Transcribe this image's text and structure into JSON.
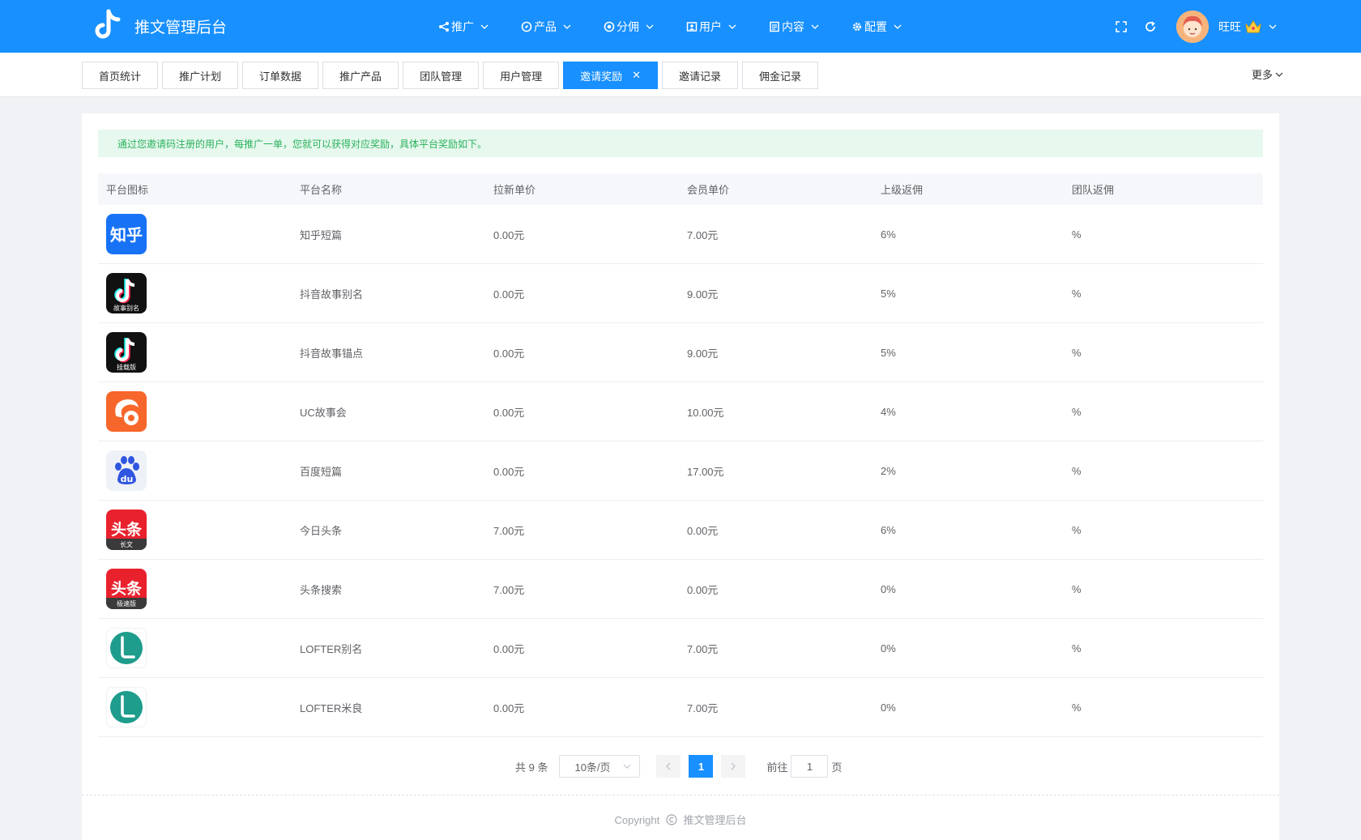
{
  "header": {
    "title": "推文管理后台",
    "nav": [
      {
        "label": "推广",
        "icon": "share-icon"
      },
      {
        "label": "产品",
        "icon": "compass-icon"
      },
      {
        "label": "分佣",
        "icon": "target-icon"
      },
      {
        "label": "用户",
        "icon": "user-card-icon"
      },
      {
        "label": "内容",
        "icon": "document-icon"
      },
      {
        "label": "配置",
        "icon": "gear-icon"
      }
    ],
    "username": "旺旺"
  },
  "tabs": [
    {
      "label": "首页统计",
      "active": false
    },
    {
      "label": "推广计划",
      "active": false
    },
    {
      "label": "订单数据",
      "active": false
    },
    {
      "label": "推广产品",
      "active": false
    },
    {
      "label": "团队管理",
      "active": false
    },
    {
      "label": "用户管理",
      "active": false
    },
    {
      "label": "邀请奖励",
      "active": true
    },
    {
      "label": "邀请记录",
      "active": false
    },
    {
      "label": "佣金记录",
      "active": false
    }
  ],
  "more_label": "更多",
  "notice": "通过您邀请码注册的用户，每推广一单，您就可以获得对应奖励，具体平台奖励如下。",
  "table": {
    "columns": [
      "平台图标",
      "平台名称",
      "拉新单价",
      "会员单价",
      "上级返佣",
      "团队返佣"
    ],
    "rows": [
      {
        "icon": "zhihu-logo-icon",
        "name": "知乎短篇",
        "new_price": "0.00元",
        "member_price": "7.00元",
        "upline": "6%",
        "team": "%"
      },
      {
        "icon": "douyin-story-alias-icon",
        "name": "抖音故事别名",
        "new_price": "0.00元",
        "member_price": "9.00元",
        "upline": "5%",
        "team": "%"
      },
      {
        "icon": "douyin-story-anchor-icon",
        "name": "抖音故事锚点",
        "new_price": "0.00元",
        "member_price": "9.00元",
        "upline": "5%",
        "team": "%"
      },
      {
        "icon": "uc-logo-icon",
        "name": "UC故事会",
        "new_price": "0.00元",
        "member_price": "10.00元",
        "upline": "4%",
        "team": "%"
      },
      {
        "icon": "baidu-logo-icon",
        "name": "百度短篇",
        "new_price": "0.00元",
        "member_price": "17.00元",
        "upline": "2%",
        "team": "%"
      },
      {
        "icon": "toutiao-long-icon",
        "name": "今日头条",
        "new_price": "7.00元",
        "member_price": "0.00元",
        "upline": "6%",
        "team": "%"
      },
      {
        "icon": "toutiao-lite-icon",
        "name": "头条搜索",
        "new_price": "7.00元",
        "member_price": "0.00元",
        "upline": "0%",
        "team": "%"
      },
      {
        "icon": "lofter-logo-icon",
        "name": "LOFTER别名",
        "new_price": "0.00元",
        "member_price": "7.00元",
        "upline": "0%",
        "team": "%"
      },
      {
        "icon": "lofter-logo-icon",
        "name": "LOFTER米良",
        "new_price": "0.00元",
        "member_price": "7.00元",
        "upline": "0%",
        "team": "%"
      }
    ]
  },
  "icon_text": {
    "zhihu": "知乎",
    "douyin_alias": "故事别名",
    "douyin_anchor": "挂载版",
    "baidu": "du",
    "toutiao": "头条",
    "toutiao_long": "长文",
    "toutiao_lite": "极速版"
  },
  "pagination": {
    "total": "共 9 条",
    "page_size": "10条/页",
    "current_page": "1",
    "goto_label": "前往",
    "goto_value": "1",
    "page_suffix": "页"
  },
  "footer": {
    "copyright": "Copyright",
    "site": "推文管理后台"
  },
  "colors": {
    "primary": "#1890ff",
    "notice_bg": "#e7f8ee",
    "notice_text": "#29b25c"
  }
}
